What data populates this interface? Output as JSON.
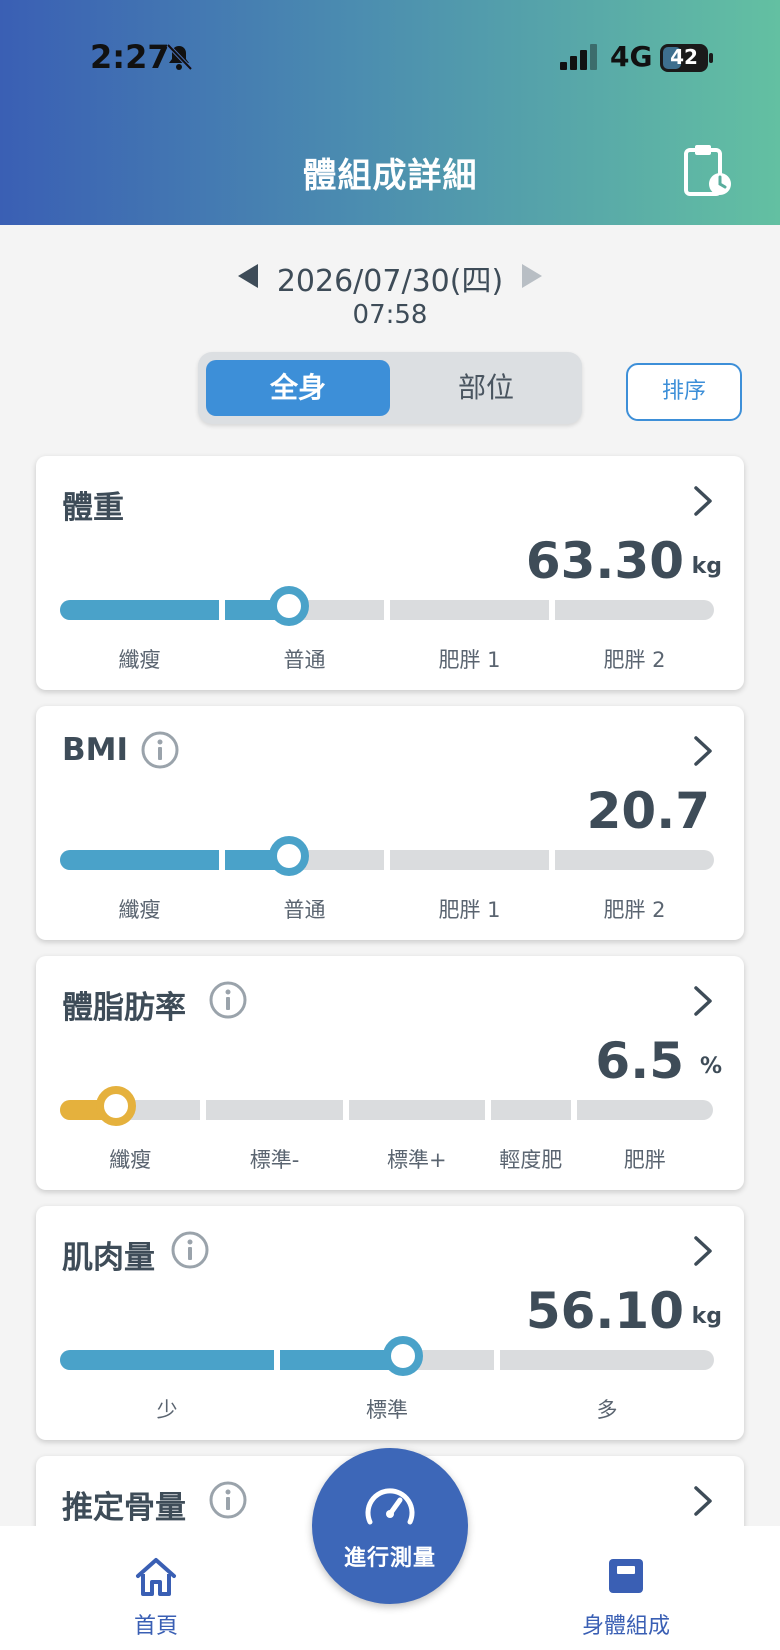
{
  "status_bar": {
    "time": "2:27",
    "network": "4G",
    "battery": "42",
    "battery_level": 0.42
  },
  "header": {
    "title": "體組成詳細"
  },
  "date_nav": {
    "date": "2026/07/30(四)",
    "time": "07:58"
  },
  "segment": {
    "active_label": "全身",
    "inactive_label": "部位"
  },
  "sort_label": "排序",
  "cards": [
    {
      "title": "體重",
      "value": "63.30",
      "unit": "kg",
      "has_info": false,
      "fill_color": "#4aa2c9",
      "segments": [
        "纖瘦",
        "普通",
        "肥胖 1",
        "肥胖 2"
      ],
      "position": 0.35
    },
    {
      "title": "BMI",
      "value": "20.7",
      "unit": "",
      "has_info": true,
      "fill_color": "#4aa2c9",
      "segments": [
        "纖瘦",
        "普通",
        "肥胖 1",
        "肥胖 2"
      ],
      "position": 0.35
    },
    {
      "title": "體脂肪率",
      "value": "6.5",
      "unit": "%",
      "has_info": true,
      "fill_color": "#e5b13d",
      "segments": [
        "纖瘦",
        "標準-",
        "標準+",
        "輕度肥",
        "肥胖"
      ],
      "position": 0.085
    },
    {
      "title": "肌肉量",
      "value": "56.10",
      "unit": "kg",
      "has_info": true,
      "fill_color": "#4aa2c9",
      "segments": [
        "少",
        "標準",
        "多"
      ],
      "position": 0.525
    },
    {
      "title": "推定骨量",
      "value": "",
      "unit": "",
      "has_info": true,
      "fill_color": "#4aa2c9",
      "segments": [],
      "position": 0
    }
  ],
  "bottom_nav": {
    "home_label": "首頁",
    "measure_label": "進行測量",
    "body_label": "身體組成"
  },
  "colors": {
    "accent": "#3d8fd8",
    "nav_blue": "#3a5fb4",
    "bar_blue": "#4aa2c9",
    "bar_yellow": "#e5b13d",
    "bar_gray": "#dadcde"
  }
}
